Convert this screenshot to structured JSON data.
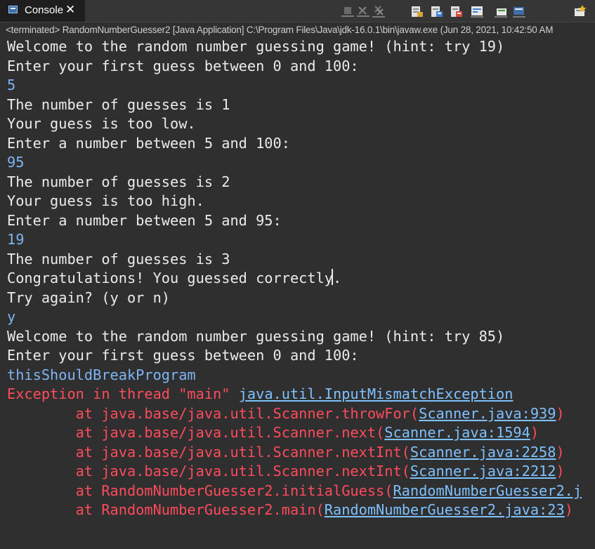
{
  "tab": {
    "label": "Console",
    "close": "✕"
  },
  "status": {
    "text": "<terminated> RandomNumberGuesser2 [Java Application] C:\\Program Files\\Java\\jdk-16.0.1\\bin\\javaw.exe  (Jun 28, 2021, 10:42:50 AM"
  },
  "toolbar": {
    "icons": [
      "terminate-icon",
      "remove-launch-icon",
      "remove-all-terminated-icon",
      "scroll-lock-icon",
      "show-when-stdout-icon",
      "show-when-stderr-icon",
      "word-wrap-icon",
      "pin-console-icon",
      "display-selected-console-icon",
      "open-console-icon"
    ]
  },
  "console": {
    "lines": [
      "Welcome to the random number guessing game! (hint: try 19)",
      "Enter your first guess between 0 and 100:",
      "5",
      "The number of guesses is 1",
      "Your guess is too low.",
      "Enter a number between 5 and 100:",
      "95",
      "The number of guesses is 2",
      "Your guess is too high.",
      "Enter a number between 5 and 95:",
      "19",
      "The number of guesses is 3",
      "Congratulations! You guessed correctly.",
      "Try again? (y or n)",
      "y",
      "Welcome to the random number guessing game! (hint: try 85)",
      "Enter your first guess between 0 and 100:",
      "thisShouldBreakProgram"
    ],
    "exception": {
      "prefix": "Exception in thread \"main\" ",
      "link": "java.util.InputMismatchException"
    },
    "stack": [
      {
        "text": "\tat java.base/java.util.Scanner.throwFor(",
        "link": "Scanner.java:939",
        "end": ")"
      },
      {
        "text": "\tat java.base/java.util.Scanner.next(",
        "link": "Scanner.java:1594",
        "end": ")"
      },
      {
        "text": "\tat java.base/java.util.Scanner.nextInt(",
        "link": "Scanner.java:2258",
        "end": ")"
      },
      {
        "text": "\tat java.base/java.util.Scanner.nextInt(",
        "link": "Scanner.java:2212",
        "end": ")"
      },
      {
        "text": "\tat RandomNumberGuesser2.initialGuess(",
        "link": "RandomNumberGuesser2.j",
        "end": ""
      },
      {
        "text": "\tat RandomNumberGuesser2.main(",
        "link": "RandomNumberGuesser2.java:23",
        "end": ")"
      }
    ]
  },
  "colors": {
    "background": "#2f2f2f",
    "stdout": "#ebebeb",
    "stdin": "#7fb4f3",
    "stderr": "#ff4b5c",
    "link": "#7fc0ff"
  }
}
